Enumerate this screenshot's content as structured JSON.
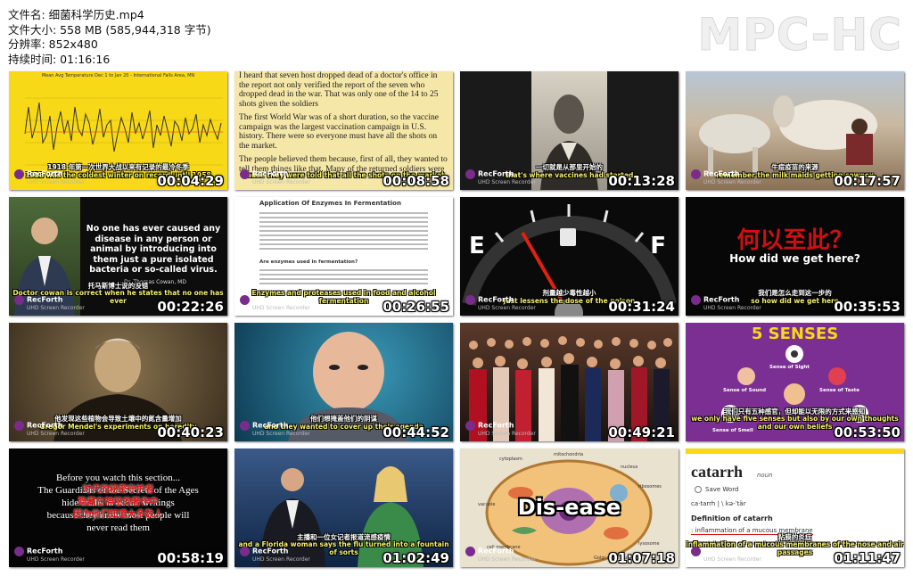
{
  "info": {
    "file_name": "文件名: 细菌科学历史.mp4",
    "file_size": "文件大小: 558 MB (585,944,318 字节)",
    "resolution": "分辨率: 852x480",
    "duration": "持续时间: 01:16:16"
  },
  "brand": "MPC-HC",
  "watermark": {
    "name": "RecForth",
    "small": "UHD Screen Recorder"
  },
  "thumbnails": [
    {
      "time": "00:04:29",
      "sub_cn": "1918 年第一次世界大战以来有记录的最冷冬季",
      "sub_en": "1918 was the coldest winter on record until 1958"
    },
    {
      "time": "00:08:58",
      "sub_cn": "",
      "sub_en": "cause they were told that all the shots on the market"
    },
    {
      "time": "00:13:28",
      "sub_cn": "一切就是从那里开始的",
      "sub_en": "that's where vaccines had started"
    },
    {
      "time": "00:17:57",
      "sub_cn": "牛痘疫苗的来源",
      "sub_en": "remember the milk maids getting cowpox"
    },
    {
      "time": "00:22:26",
      "sub_cn": "托马斯博士说的没错",
      "sub_en": "Doctor cowan is correct when he states that no one has ever"
    },
    {
      "time": "00:26:55",
      "sub_cn": "",
      "sub_en": "Enzymes and proteases used in food and alcohol fermentation"
    },
    {
      "time": "00:31:24",
      "sub_cn": "剂量越少毒性越小",
      "sub_en": "just lessens the dose of the poison"
    },
    {
      "time": "00:35:53",
      "sub_cn": "我们是怎么走到这一步的",
      "sub_en": "so how did we get here"
    },
    {
      "time": "00:40:23",
      "sub_cn": "他发现这些植物会导致土壤中的氮含量增加",
      "sub_en": "Gregor Mendel's experiments on heredity"
    },
    {
      "time": "00:44:52",
      "sub_cn": "他们想掩盖他们的阴谋",
      "sub_en": "and they wanted to cover up their agenda"
    },
    {
      "time": "00:49:21",
      "sub_cn": "",
      "sub_en": ""
    },
    {
      "time": "00:53:50",
      "sub_cn": "我们只有五种感官，但却能以无限的方式来感知",
      "sub_en": "we only have five senses but also by our own thoughts and our own beliefs"
    },
    {
      "time": "00:58:19",
      "sub_cn": "",
      "sub_en": ""
    },
    {
      "time": "01:02:49",
      "sub_cn": "主播和一位女记者报道流感疫情",
      "sub_en": "and a Florida woman says the flu turned into a fountain of sorts"
    },
    {
      "time": "01:07:18",
      "sub_cn": "",
      "sub_en": ""
    },
    {
      "time": "01:11:47",
      "sub_cn": "粘膜的炎症",
      "sub_en": "inflammation of a mucous membranes of the nose and air passages"
    }
  ],
  "t1": {
    "title": "Mean Avg Temperature Dec 1 to Jan 20 - International Falls Area, MN"
  },
  "t2": {
    "p1": "I heard that seven host dropped dead of a doctor's office in the report not only verified the report of the seven who dropped dead in the war. That was only one of the 14 to 25 shots given the soldiers",
    "p2": "The first World War was of a short duration, so the vaccine campaign was the largest vaccination campaign in U.S. history. There were so everyone must have all the shots on the market.",
    "p3": "The people believed them because, first of all, they wanted to tell them things like that. Many of the returned soldiers were"
  },
  "t5": {
    "quote": "No one has ever caused any disease in any person or animal by introducing into them just a pure isolated bacteria or so-called virus.",
    "author": "- Dr. Thomas Cowan, MD"
  },
  "t6": {
    "heading": "Application Of Enzymes In Fermentation",
    "subheading": "Are enzymes used in fermentation?"
  },
  "t7": {
    "left": "E",
    "right": "F"
  },
  "t8": {
    "cn": "何以至此？",
    "en": "How did we get here?"
  },
  "t12": {
    "title": "5 SENSES",
    "sight": "Sense of Sight",
    "sound": "Sense of Sound",
    "taste": "Sense of Taste",
    "smell": "Sense of Smell",
    "touch": "Sen"
  },
  "t13": {
    "line1": "Before you watch this section...",
    "line2": "The Guardians of the Secrets of the Ages",
    "line3": "hide truths in occult writings",
    "line4": "because they know most people will",
    "line5": "never read them",
    "cn1": "时代的秘密守护者",
    "cn2": "隐藏在神秘的著作中",
    "cn3": "因为他们知道大多数人"
  },
  "t15": {
    "word": "Dis-ease",
    "labels": [
      "cytoplasm",
      "mitochondria",
      "nucleus",
      "ribosomes",
      "lysosome",
      "Golgi apparatus",
      "vacuole",
      "cell membrane"
    ]
  },
  "t16": {
    "word": "catarrh",
    "pos": "noun",
    "save": "Save Word",
    "pron": "ca·tarrh | \\ kə-ˈtär",
    "def_title": "Definition of catarrh",
    "def1": ": inflammation of a mucous membrane",
    "def2": "especially : one chronically affecting the human nose and air passages"
  },
  "colors": {
    "yellow": "#f7d917",
    "purple": "#7b2f93",
    "red": "#d01010"
  }
}
